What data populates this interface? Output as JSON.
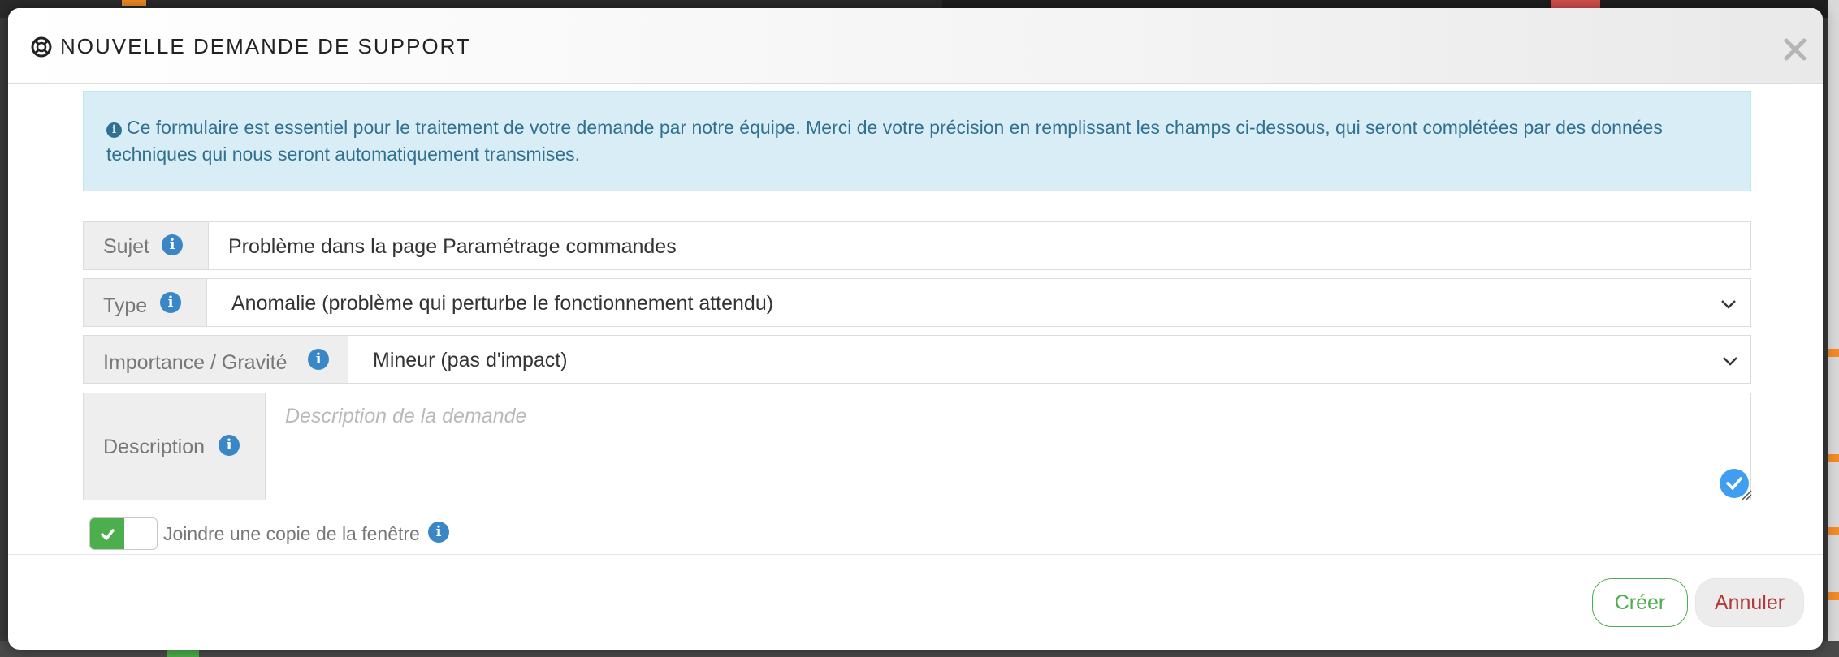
{
  "modal": {
    "title": "NOUVELLE DEMANDE DE SUPPORT",
    "close_symbol": "✕"
  },
  "alert": {
    "text": "Ce formulaire est essentiel pour le traitement de votre demande par notre équipe. Merci de votre précision en remplissant les champs ci-dessous, qui seront complétées par des données techniques qui nous seront automatiquement transmises."
  },
  "form": {
    "subject": {
      "label": "Sujet",
      "value": "Problème dans la page Paramétrage commandes"
    },
    "type": {
      "label": "Type",
      "selected": "Anomalie (problème qui perturbe le fonctionnement attendu)"
    },
    "severity": {
      "label": "Importance / Gravité",
      "selected": "Mineur (pas d'impact)"
    },
    "description": {
      "label": "Description",
      "placeholder": "Description de la demande",
      "value": ""
    },
    "attach_window": {
      "label": "Joindre une copie de la fenêtre",
      "checked": true
    }
  },
  "buttons": {
    "create": "Créer",
    "cancel": "Annuler"
  },
  "icons": {
    "header": "lifebuoy-icon",
    "info": "info-icon",
    "dropdown": "chevron-down-icon",
    "spellcheck": "check-circle-icon"
  },
  "colors": {
    "alert_bg": "#d9edf7",
    "alert_text": "#31708f",
    "info_icon": "#3a87c8",
    "success": "#4cae4c",
    "danger": "#b33a3a"
  }
}
